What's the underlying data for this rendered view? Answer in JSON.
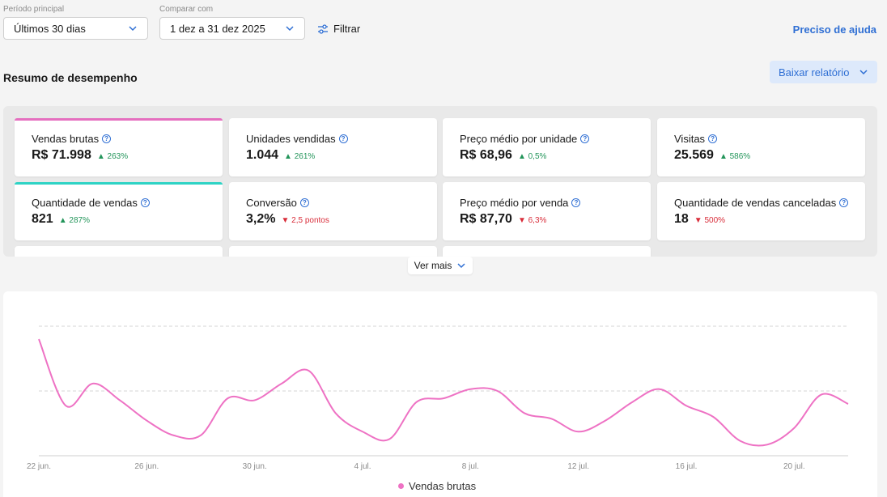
{
  "filters": {
    "period_label": "Período principal",
    "period_value": "Últimos 30 dias",
    "compare_label": "Comparar com",
    "compare_value": "1 dez a 31 dez 2025",
    "filter_button": "Filtrar",
    "help_link": "Preciso de ajuda"
  },
  "summary": {
    "title": "Resumo de desempenho",
    "download_button": "Baixar relatório",
    "see_more": "Ver mais"
  },
  "kpis": [
    {
      "title": "Vendas brutas",
      "value": "R$ 71.998",
      "delta": "263%",
      "direction": "up",
      "accent": "#e56fbf"
    },
    {
      "title": "Unidades vendidas",
      "value": "1.044",
      "delta": "261%",
      "direction": "up"
    },
    {
      "title": "Preço médio por unidade",
      "value": "R$ 68,96",
      "delta": "0,5%",
      "direction": "up"
    },
    {
      "title": "Visitas",
      "value": "25.569",
      "delta": "586%",
      "direction": "up"
    },
    {
      "title": "Quantidade de vendas",
      "value": "821",
      "delta": "287%",
      "direction": "up",
      "accent": "#2ed3c5"
    },
    {
      "title": "Conversão",
      "value": "3,2%",
      "delta": "2,5 pontos",
      "direction": "down"
    },
    {
      "title": "Preço médio por venda",
      "value": "R$ 87,70",
      "delta": "6,3%",
      "direction": "down"
    },
    {
      "title": "Quantidade de vendas canceladas",
      "value": "18",
      "delta": "500%",
      "direction": "down"
    }
  ],
  "colors": {
    "accent_blue": "#2f6fd4",
    "series_pink": "#ee72c4",
    "up_green": "#23955a",
    "down_red": "#d92d3a"
  },
  "chart_data": {
    "type": "line",
    "x": [
      "22 jun.",
      "23 jun.",
      "24 jun.",
      "25 jun.",
      "26 jun.",
      "27 jun.",
      "28 jun.",
      "29 jun.",
      "30 jun.",
      "1 jul.",
      "2 jul.",
      "3 jul.",
      "4 jul.",
      "5 jul.",
      "6 jul.",
      "7 jul.",
      "8 jul.",
      "9 jul.",
      "10 jul.",
      "11 jul.",
      "12 jul.",
      "13 jul.",
      "14 jul.",
      "15 jul.",
      "16 jul.",
      "17 jul.",
      "18 jul.",
      "19 jul.",
      "20 jul.",
      "21 jul.",
      "22 jul."
    ],
    "tick_labels": [
      "22 jun.",
      "26 jun.",
      "30 jun.",
      "4 jul.",
      "8 jul.",
      "12 jul.",
      "16 jul.",
      "20 jul."
    ],
    "series": [
      {
        "name": "Vendas brutas",
        "values": [
          3.15,
          1.35,
          1.95,
          1.5,
          0.95,
          0.55,
          0.55,
          1.55,
          1.5,
          1.95,
          2.3,
          1.15,
          0.65,
          0.45,
          1.45,
          1.55,
          1.8,
          1.75,
          1.15,
          1.0,
          0.65,
          0.95,
          1.45,
          1.8,
          1.35,
          1.05,
          0.4,
          0.3,
          0.75,
          1.65,
          1.4
        ]
      }
    ],
    "ylim": [
      0,
      3.5
    ],
    "grid": true,
    "legend": "bottom-center"
  }
}
